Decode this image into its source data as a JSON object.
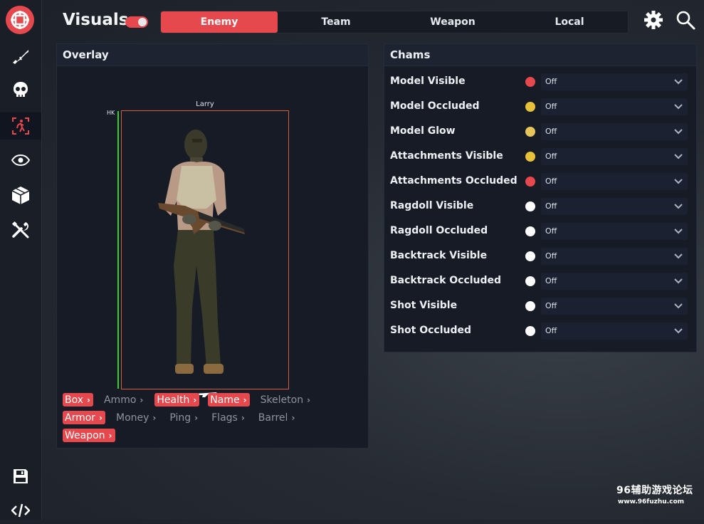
{
  "header": {
    "title": "Visuals",
    "toggle_on": true,
    "tabs": [
      {
        "label": "Enemy",
        "active": true
      },
      {
        "label": "Team",
        "active": false
      },
      {
        "label": "Weapon",
        "active": false
      },
      {
        "label": "Local",
        "active": false
      }
    ],
    "icons": [
      "gear-icon",
      "search-icon"
    ]
  },
  "sidebar": {
    "items": [
      {
        "icon": "rifle-icon",
        "active": false
      },
      {
        "icon": "skull-icon",
        "active": false
      },
      {
        "icon": "player-icon",
        "active": true
      },
      {
        "icon": "eye-icon",
        "active": false
      },
      {
        "icon": "box-icon",
        "active": false
      },
      {
        "icon": "tools-icon",
        "active": false
      },
      {
        "icon": "save-icon",
        "active": false
      },
      {
        "icon": "code-icon",
        "active": false
      }
    ]
  },
  "overlay": {
    "title": "Overlay",
    "preview": {
      "name": "Larry",
      "hk": "HK",
      "health_fraction": 1.0
    },
    "chips": [
      {
        "label": "Box",
        "on": true
      },
      {
        "label": "Ammo",
        "on": false
      },
      {
        "label": "Health",
        "on": true
      },
      {
        "label": "Name",
        "on": true
      },
      {
        "label": "Skeleton",
        "on": false
      },
      {
        "label": "Armor",
        "on": true
      },
      {
        "label": "Money",
        "on": false
      },
      {
        "label": "Ping",
        "on": false
      },
      {
        "label": "Flags",
        "on": false
      },
      {
        "label": "Barrel",
        "on": false
      },
      {
        "label": "Weapon",
        "on": true
      }
    ]
  },
  "chams": {
    "title": "Chams",
    "rows": [
      {
        "label": "Model Visible",
        "color": "#e5484d",
        "value": "Off"
      },
      {
        "label": "Model Occluded",
        "color": "#e8c13a",
        "value": "Off"
      },
      {
        "label": "Model Glow",
        "color": "#e6c65a",
        "value": "Off"
      },
      {
        "label": "Attachments Visible",
        "color": "#e8c13a",
        "value": "Off"
      },
      {
        "label": "Attachments Occluded",
        "color": "#e5484d",
        "value": "Off"
      },
      {
        "label": "Ragdoll Visible",
        "color": "#ffffff",
        "value": "Off"
      },
      {
        "label": "Ragdoll Occluded",
        "color": "#ffffff",
        "value": "Off"
      },
      {
        "label": "Backtrack Visible",
        "color": "#ffffff",
        "value": "Off"
      },
      {
        "label": "Backtrack Occluded",
        "color": "#ffffff",
        "value": "Off"
      },
      {
        "label": "Shot Visible",
        "color": "#ffffff",
        "value": "Off"
      },
      {
        "label": "Shot Occluded",
        "color": "#ffffff",
        "value": "Off"
      }
    ]
  },
  "watermark": {
    "line1": "96辅助游戏论坛",
    "line2": "www.96fuzhu.com"
  },
  "colors": {
    "accent": "#e5484d",
    "health": "#36d02f",
    "box": "#d65a44"
  }
}
